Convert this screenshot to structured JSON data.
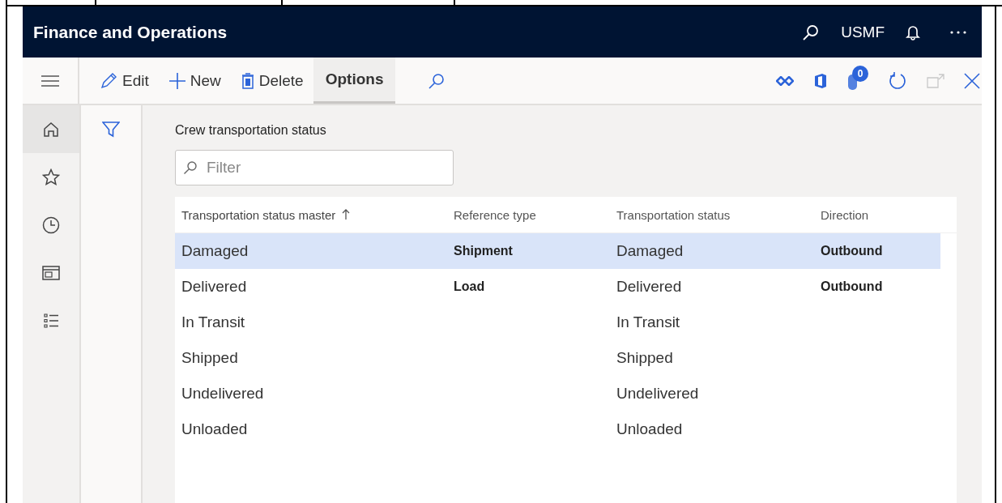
{
  "app": {
    "title": "Finance and Operations",
    "company": "USMF"
  },
  "nav": [
    {
      "selected": true
    },
    {
      "selected": false
    },
    {
      "selected": false
    },
    {
      "selected": false
    },
    {
      "selected": false
    }
  ],
  "toolbar": {
    "actions": [
      {
        "label": "Edit",
        "selected": false
      },
      {
        "label": "New",
        "selected": false
      },
      {
        "label": "Delete",
        "selected": false
      },
      {
        "label": "Options",
        "selected": true
      }
    ],
    "attachment_count": "0"
  },
  "page": {
    "title": "Crew transportation status",
    "filter": {
      "placeholder": "Filter"
    }
  },
  "table": {
    "columns": [
      {
        "label": "Transportation status master",
        "sorted": true
      },
      {
        "label": "Reference type",
        "sorted": false
      },
      {
        "label": "Transportation status",
        "sorted": false
      },
      {
        "label": "Direction",
        "sorted": false
      }
    ],
    "rows": [
      {
        "master": "Damaged",
        "reference_type": "Shipment",
        "status": "Damaged",
        "direction": "Outbound",
        "selected": true
      },
      {
        "master": "Delivered",
        "reference_type": "Load",
        "status": "Delivered",
        "direction": "Outbound",
        "selected": false
      },
      {
        "master": "In Transit",
        "status": "In Transit",
        "selected": false
      },
      {
        "master": "Shipped",
        "status": "Shipped",
        "selected": false
      },
      {
        "master": "Undelivered",
        "status": "Undelivered",
        "selected": false
      },
      {
        "master": "Unloaded",
        "status": "Unloaded",
        "selected": false
      }
    ]
  }
}
